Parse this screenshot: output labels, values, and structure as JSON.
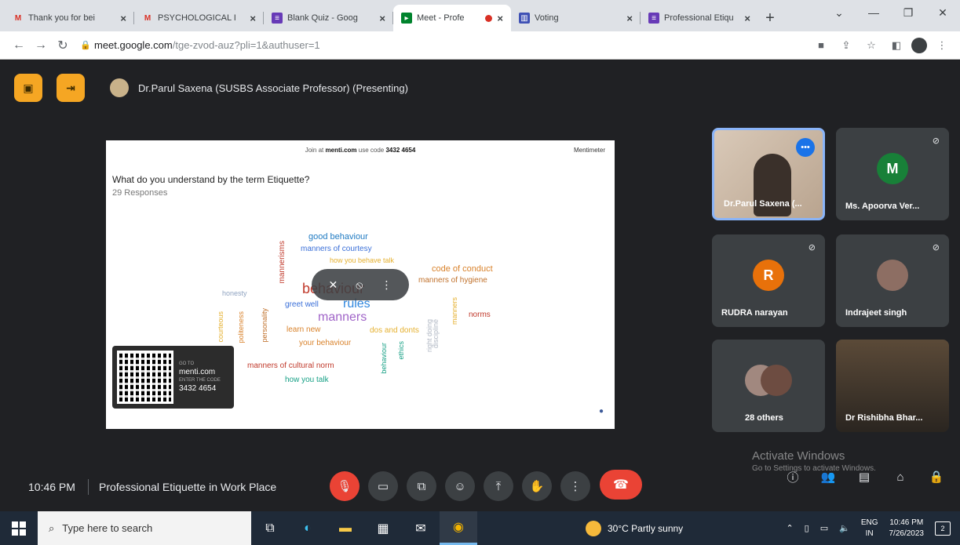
{
  "browser": {
    "tabs": [
      {
        "title": "Thank you for bei",
        "icon": "gmail-icon"
      },
      {
        "title": "PSYCHOLOGICAL I",
        "icon": "gmail-icon"
      },
      {
        "title": "Blank Quiz - Goog",
        "icon": "forms-icon"
      },
      {
        "title": "Meet - Profe",
        "icon": "meet-icon"
      },
      {
        "title": "Voting",
        "icon": "chart-icon"
      },
      {
        "title": "Professional Etiqu",
        "icon": "forms-icon"
      }
    ],
    "url_host": "meet.google.com",
    "url_path": "/tge-zvod-auz?pli=1&authuser=1"
  },
  "meet": {
    "presenter": "Dr.Parul Saxena (SUSBS Associate Professor) (Presenting)",
    "time": "10:46 PM",
    "meeting_title": "Professional Etiquette in Work Place"
  },
  "slide": {
    "join_text_a": "Join at",
    "join_site": "menti.com",
    "join_text_b": "use code",
    "join_code": "3432 4654",
    "brand": "Mentimeter",
    "question": "What do you understand by the term Etiquette?",
    "responses": "29 Responses",
    "qr_site_label": "GO TO",
    "qr_site": "menti.com",
    "qr_code_label": "ENTER THE CODE",
    "qr_code": "3432 4654",
    "words": [
      {
        "text": "good behaviour",
        "color": "#1f7ac2"
      },
      {
        "text": "manners of courtesy",
        "color": "#3a6fd8"
      },
      {
        "text": "how you behave talk",
        "color": "#e5b02f"
      },
      {
        "text": "code of conduct",
        "color": "#d9822b"
      },
      {
        "text": "manners of hygiene",
        "color": "#c0702a"
      },
      {
        "text": "behaviour",
        "color": "#c0392b"
      },
      {
        "text": "rules",
        "color": "#2e86de"
      },
      {
        "text": "manners",
        "color": "#a064c8"
      },
      {
        "text": "greet well",
        "color": "#3a6fd8"
      },
      {
        "text": "honesty",
        "color": "#8fa3c0"
      },
      {
        "text": "norms",
        "color": "#c0392b"
      },
      {
        "text": "learn new",
        "color": "#d9822b"
      },
      {
        "text": "your behaviour",
        "color": "#d9822b"
      },
      {
        "text": "dos and donts",
        "color": "#e5b02f"
      },
      {
        "text": "manners of cultural norm",
        "color": "#c0392b"
      },
      {
        "text": "how you talk",
        "color": "#16a085"
      },
      {
        "text": "mannerisms",
        "color": "#c0392b"
      },
      {
        "text": "politeness",
        "color": "#d9822b"
      },
      {
        "text": "personality",
        "color": "#c0702a"
      },
      {
        "text": "behaviour",
        "color": "#16a085"
      },
      {
        "text": "ethics",
        "color": "#16a085"
      },
      {
        "text": "right doing",
        "color": "#b0b7c3"
      },
      {
        "text": "manners",
        "color": "#e5b02f"
      },
      {
        "text": "courteous",
        "color": "#e5b02f"
      },
      {
        "text": "discipline",
        "color": "#b0b7c3"
      }
    ]
  },
  "participants": [
    {
      "name": "Dr.Parul Saxena (...",
      "initial": ""
    },
    {
      "name": "Ms. Apoorva Ver...",
      "initial": "M",
      "color": "#188038"
    },
    {
      "name": "RUDRA narayan",
      "initial": "R",
      "color": "#e8710a"
    },
    {
      "name": "Indrajeet singh",
      "initial": ""
    },
    {
      "name": "28 others",
      "initial": ""
    },
    {
      "name": "Dr Rishibha Bhar...",
      "initial": ""
    }
  ],
  "watermark": {
    "title": "Activate Windows",
    "sub": "Go to Settings to activate Windows."
  },
  "taskbar": {
    "search_placeholder": "Type here to search",
    "weather": "30°C  Partly sunny",
    "lang_a": "ENG",
    "lang_b": "IN",
    "time": "10:46 PM",
    "date": "7/26/2023",
    "notifications": "2"
  }
}
